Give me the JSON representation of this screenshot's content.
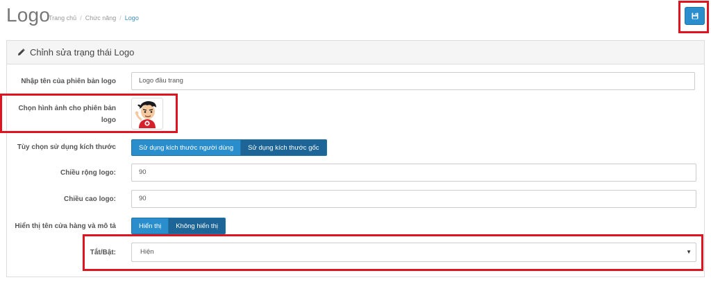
{
  "header": {
    "title": "Logo",
    "breadcrumb": [
      "Trang chủ",
      "Chức năng",
      "Logo"
    ]
  },
  "toolbar": {
    "save_icon": "floppy-disk-icon"
  },
  "panel": {
    "title": "Chỉnh sửa trạng thái Logo",
    "title_icon": "pencil-icon"
  },
  "form": {
    "version_name_label": "Nhập tên của phiên bản logo",
    "version_name_value": "Logo đầu trang",
    "image_label_line1": "Chọn hình ảnh cho phiên bản",
    "image_label_line2": "logo",
    "size_option_label": "Tùy chọn sử dụng kích thước",
    "size_options": [
      "Sử dụng kích thước người dùng",
      "Sử dụng kích thước gốc"
    ],
    "size_selected": "Sử dụng kích thước người dùng",
    "width_label": "Chiều rộng logo:",
    "width_value": "90",
    "height_label": "Chiều cao logo:",
    "height_value": "90",
    "show_store_label": "Hiển thị tên cửa hàng và mô tả",
    "show_store_options": [
      "Hiển thị",
      "Không hiển thị"
    ],
    "show_store_selected": "Hiển thị",
    "toggle_label": "Tắt/Bật:",
    "toggle_value": "Hiện"
  },
  "colors": {
    "primary": "#2a8ecd",
    "primary_dark": "#1c6596",
    "highlight_red": "#e0141f",
    "breadcrumb_active": "#3c8dbc"
  }
}
